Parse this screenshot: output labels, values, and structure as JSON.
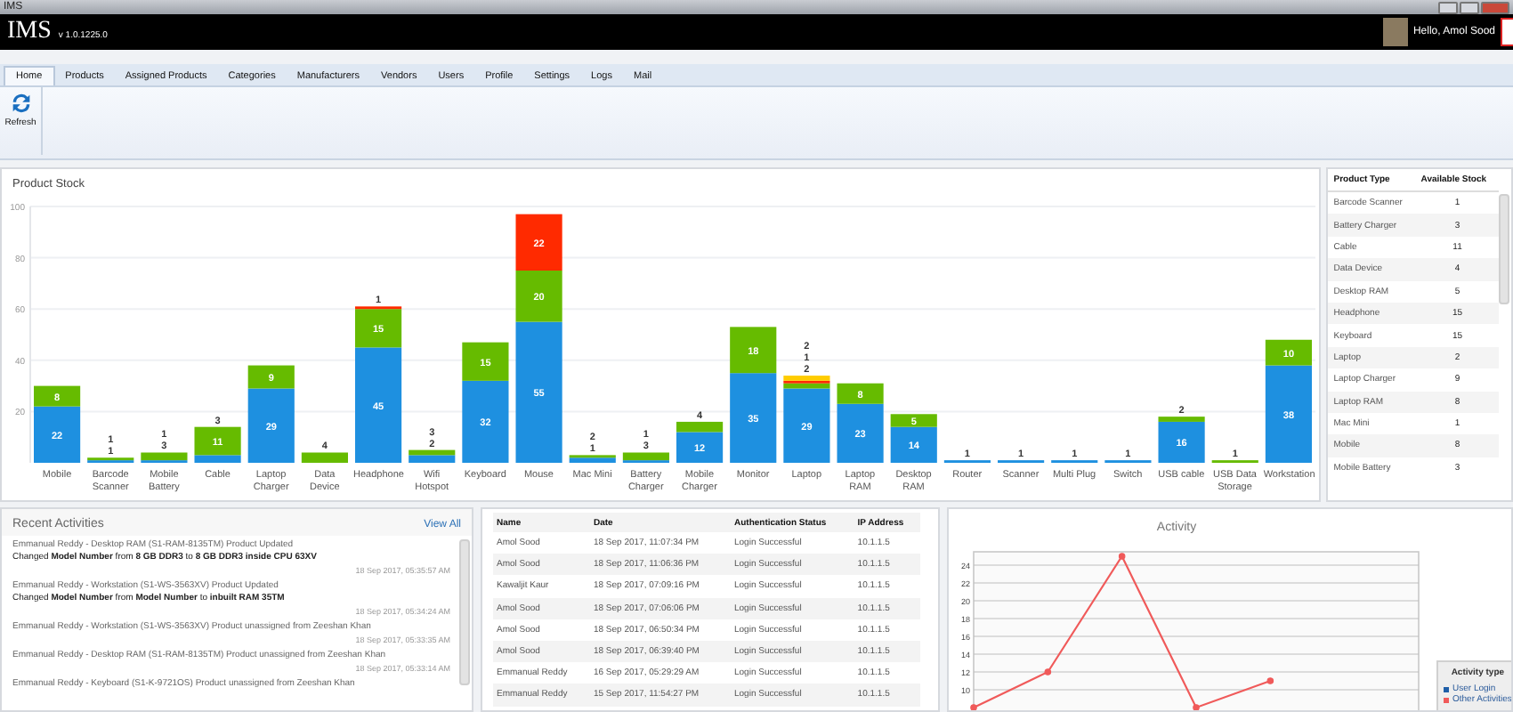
{
  "window": {
    "title": "IMS"
  },
  "header": {
    "app_name": "IMS",
    "version": "v 1.0.1225.0",
    "greeting": "Hello, Amol Sood"
  },
  "tabs": [
    {
      "label": "Home",
      "selected": true
    },
    {
      "label": "Products",
      "selected": false
    },
    {
      "label": "Assigned Products",
      "selected": false
    },
    {
      "label": "Categories",
      "selected": false
    },
    {
      "label": "Manufacturers",
      "selected": false
    },
    {
      "label": "Vendors",
      "selected": false
    },
    {
      "label": "Users",
      "selected": false
    },
    {
      "label": "Profile",
      "selected": false
    },
    {
      "label": "Settings",
      "selected": false
    },
    {
      "label": "Logs",
      "selected": false
    },
    {
      "label": "Mail",
      "selected": false
    }
  ],
  "ribbon": {
    "buttons": [
      {
        "label": "Refresh"
      }
    ]
  },
  "product_stock": {
    "title": "Product Stock",
    "chart_data": {
      "type": "bar",
      "stacked": true,
      "grid": true,
      "data_labels": true,
      "ylim": [
        0,
        100
      ],
      "yticks": [
        20,
        40,
        60,
        80,
        100
      ],
      "categories": [
        "Mobile",
        "Barcode Scanner",
        "Mobile Battery",
        "Cable",
        "Laptop Charger",
        "Data Device",
        "Headphone",
        "Wifi Hotspot",
        "Keyboard",
        "Mouse",
        "Mac Mini",
        "Battery Charger",
        "Mobile Charger",
        "Monitor",
        "Laptop",
        "Laptop RAM",
        "Desktop RAM",
        "Router",
        "Scanner",
        "Multi Plug",
        "Switch",
        "USB cable",
        "USB Data Storage",
        "Workstation"
      ],
      "series": [
        {
          "color": "#1e90e0",
          "values": [
            22,
            1,
            1,
            3,
            29,
            null,
            45,
            3,
            32,
            55,
            2,
            1,
            12,
            35,
            29,
            23,
            14,
            1,
            1,
            1,
            1,
            16,
            null,
            38
          ]
        },
        {
          "color": "#66bb00",
          "values": [
            8,
            1,
            3,
            11,
            9,
            4,
            15,
            2,
            15,
            20,
            1,
            3,
            4,
            18,
            2,
            8,
            5,
            null,
            null,
            null,
            null,
            2,
            1,
            10
          ]
        },
        {
          "color": "#ff2a00",
          "values": [
            null,
            null,
            null,
            null,
            null,
            null,
            1,
            null,
            null,
            22,
            null,
            null,
            null,
            null,
            1,
            null,
            null,
            null,
            null,
            null,
            null,
            null,
            null,
            null
          ]
        },
        {
          "color": "#ffcc00",
          "values": [
            null,
            null,
            null,
            null,
            null,
            null,
            null,
            null,
            null,
            null,
            null,
            null,
            null,
            null,
            2,
            null,
            null,
            null,
            null,
            null,
            null,
            null,
            null,
            null
          ]
        }
      ]
    }
  },
  "stock_table": {
    "columns": [
      "Product Type",
      "Available Stock"
    ],
    "rows": [
      [
        "Barcode Scanner",
        "1"
      ],
      [
        "Battery Charger",
        "3"
      ],
      [
        "Cable",
        "11"
      ],
      [
        "Data Device",
        "4"
      ],
      [
        "Desktop RAM",
        "5"
      ],
      [
        "Headphone",
        "15"
      ],
      [
        "Keyboard",
        "15"
      ],
      [
        "Laptop",
        "2"
      ],
      [
        "Laptop Charger",
        "9"
      ],
      [
        "Laptop RAM",
        "8"
      ],
      [
        "Mac Mini",
        "1"
      ],
      [
        "Mobile",
        "8"
      ],
      [
        "Mobile Battery",
        "3"
      ]
    ]
  },
  "recent_activities": {
    "title": "Recent Activities",
    "link": "View All",
    "items": [
      {
        "text": "Emmanual Reddy - Desktop RAM (S1-RAM-8135TM) Product Updated",
        "detail": "Changed **Model Number** from **8 GB DDR3** to **8 GB DDR3 inside CPU 63XV**",
        "time": "18 Sep 2017, 05:35:57 AM"
      },
      {
        "text": "Emmanual Reddy - Workstation (S1-WS-3563XV) Product Updated",
        "detail": "Changed **Model Number** from **Model Number** to **inbuilt RAM 35TM**",
        "time": "18 Sep 2017, 05:34:24 AM"
      },
      {
        "text": "Emmanual Reddy - Workstation (S1-WS-3563XV) Product unassigned from Zeeshan Khan",
        "time": "18 Sep 2017, 05:33:35 AM"
      },
      {
        "text": "Emmanual Reddy - Desktop RAM (S1-RAM-8135TM) Product unassigned from Zeeshan Khan",
        "time": "18 Sep 2017, 05:33:14 AM"
      },
      {
        "text": "Emmanual Reddy - Keyboard (S1-K-9721OS) Product unassigned from Zeeshan Khan"
      }
    ]
  },
  "login_table": {
    "columns": [
      "Name",
      "Date",
      "Authentication Status",
      "IP Address"
    ],
    "rows": [
      [
        "Amol Sood",
        "18 Sep 2017, 11:07:34 PM",
        "Login Successful",
        "10.1.1.5"
      ],
      [
        "Amol Sood",
        "18 Sep 2017, 11:06:36 PM",
        "Login Successful",
        "10.1.1.5"
      ],
      [
        "Kawaljit Kaur",
        "18 Sep 2017, 07:09:16 PM",
        "Login Successful",
        "10.1.1.5"
      ],
      [
        "Amol Sood",
        "18 Sep 2017, 07:06:06 PM",
        "Login Successful",
        "10.1.1.5"
      ],
      [
        "Amol Sood",
        "18 Sep 2017, 06:50:34 PM",
        "Login Successful",
        "10.1.1.5"
      ],
      [
        "Amol Sood",
        "18 Sep 2017, 06:39:40 PM",
        "Login Successful",
        "10.1.1.5"
      ],
      [
        "Emmanual Reddy",
        "16 Sep 2017, 05:29:29 AM",
        "Login Successful",
        "10.1.1.5"
      ],
      [
        "Emmanual Reddy",
        "15 Sep 2017, 11:54:27 PM",
        "Login Successful",
        "10.1.1.5"
      ]
    ]
  },
  "activity": {
    "chart_data": {
      "type": "line",
      "title": "Activity",
      "grid": true,
      "ylim": [
        7.5,
        25.5
      ],
      "yticks": [
        10,
        12,
        14,
        16,
        18,
        20,
        22,
        24
      ],
      "series": [
        {
          "name": "User Login",
          "color": "#1f5fa8",
          "values": [
            null,
            null,
            null,
            null,
            null,
            null,
            null
          ]
        },
        {
          "name": "Other Activities",
          "color": "#f05a5a",
          "marker": true,
          "values": [
            8,
            12,
            25,
            8,
            11,
            null,
            null
          ]
        }
      ]
    },
    "legend_title": "Activity type"
  }
}
